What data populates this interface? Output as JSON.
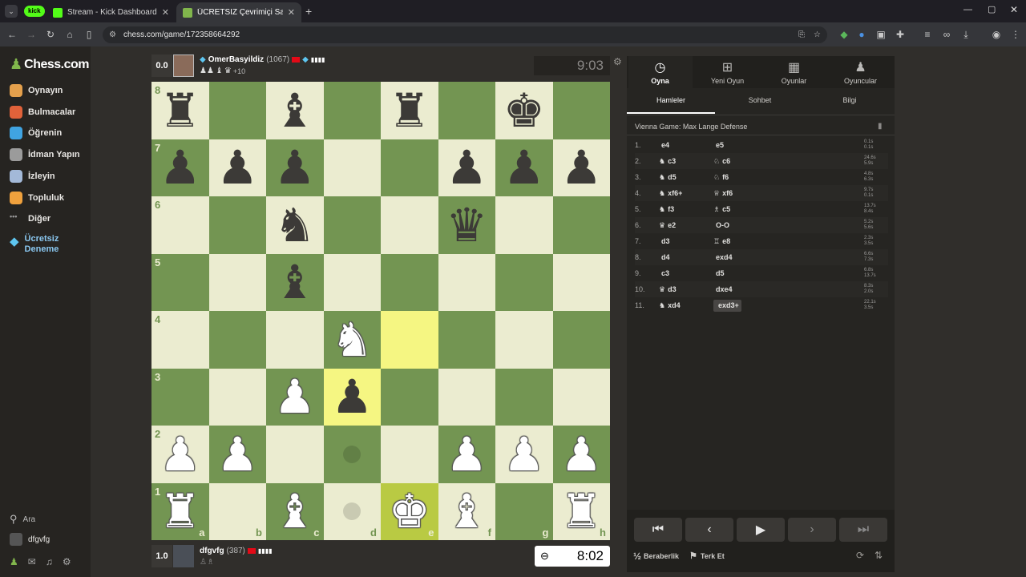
{
  "browser": {
    "tab1_badge": "kick",
    "tab1_title": "Stream - Kick Dashboard",
    "tab2_title": "ÜCRETSİZ Çevrimiçi Satranç Oy",
    "url": "chess.com/game/172358664292"
  },
  "sidebar": {
    "logo": "Chess.com",
    "items": [
      {
        "label": "Oynayın",
        "icon": "pawn-play-icon",
        "color": "#e4a04c"
      },
      {
        "label": "Bulmacalar",
        "icon": "puzzle-icon",
        "color": "#e0623a"
      },
      {
        "label": "Öğrenin",
        "icon": "learn-cap-icon",
        "color": "#40a4e2"
      },
      {
        "label": "İdman Yapın",
        "icon": "drill-icon",
        "color": "#9b9b9b"
      },
      {
        "label": "İzleyin",
        "icon": "binoculars-icon",
        "color": "#a3b9d8"
      },
      {
        "label": "Topluluk",
        "icon": "community-icon",
        "color": "#f0a13d"
      },
      {
        "label": "Diğer",
        "icon": "more-dots-icon",
        "color": "#9b9b9b"
      }
    ],
    "trial_line1": "Ücretsiz",
    "trial_line2": "Deneme",
    "search": "Ara",
    "username": "dfgvfg"
  },
  "top_player": {
    "score": "0.0",
    "name": "OmerBasyildiz",
    "rating": "(1067)",
    "material": "+10",
    "clock": "9:03"
  },
  "bottom_player": {
    "score": "1.0",
    "name": "dfgvfg",
    "rating": "(387)",
    "clock": "8:02"
  },
  "board": {
    "colors": {
      "light": "#ebecd0",
      "dark": "#739552",
      "highlight": "#f5f682"
    },
    "ranks": [
      [
        "br",
        "",
        "bb",
        "",
        "br",
        "",
        "bk",
        ""
      ],
      [
        "bp",
        "bp",
        "bp",
        "",
        "",
        "bp",
        "bp",
        "bp"
      ],
      [
        "",
        "",
        "bn",
        "",
        "",
        "bq",
        "",
        ""
      ],
      [
        "",
        "",
        "bb",
        "",
        "",
        "",
        "",
        ""
      ],
      [
        "",
        "",
        "",
        "wn",
        "",
        "",
        "",
        ""
      ],
      [
        "",
        "",
        "wp",
        "bp",
        "",
        "",
        "",
        ""
      ],
      [
        "wp",
        "wp",
        "",
        "",
        "",
        "wp",
        "wp",
        "wp"
      ],
      [
        "wr",
        "",
        "wb",
        "",
        "wk",
        "wb",
        "",
        "wr"
      ]
    ],
    "files": [
      "a",
      "b",
      "c",
      "d",
      "e",
      "f",
      "g",
      "h"
    ],
    "rank_labels": [
      "8",
      "7",
      "6",
      "5",
      "4",
      "3",
      "2",
      "1"
    ]
  },
  "panel": {
    "tabs": [
      "Oyna",
      "Yeni Oyun",
      "Oyunlar",
      "Oyuncular"
    ],
    "subtabs": [
      "Hamleler",
      "Sohbet",
      "Bilgi"
    ],
    "opening": "Vienna Game: Max Lange Defense",
    "moves": [
      {
        "n": "1.",
        "w": "e4",
        "b": "e5",
        "wt": "0.1s",
        "bt": "0.1s",
        "wp": "",
        "bp": ""
      },
      {
        "n": "2.",
        "w": "c3",
        "b": "c6",
        "wt": "24.6s",
        "bt": "5.9s",
        "wp": "♞",
        "bp": "♘"
      },
      {
        "n": "3.",
        "w": "d5",
        "b": "f6",
        "wt": "4.8s",
        "bt": "6.3s",
        "wp": "♞",
        "bp": "♘"
      },
      {
        "n": "4.",
        "w": "xf6+",
        "b": "xf6",
        "wt": "9.7s",
        "bt": "0.1s",
        "wp": "♞",
        "bp": "♕"
      },
      {
        "n": "5.",
        "w": "f3",
        "b": "c5",
        "wt": "13.7s",
        "bt": "8.4s",
        "wp": "♞",
        "bp": "♗"
      },
      {
        "n": "6.",
        "w": "e2",
        "b": "O-O",
        "wt": "5.2s",
        "bt": "5.6s",
        "wp": "♛",
        "bp": ""
      },
      {
        "n": "7.",
        "w": "d3",
        "b": "e8",
        "wt": "2.3s",
        "bt": "3.5s",
        "wp": "",
        "bp": "♖"
      },
      {
        "n": "8.",
        "w": "d4",
        "b": "exd4",
        "wt": "6.6s",
        "bt": "7.3s",
        "wp": "",
        "bp": ""
      },
      {
        "n": "9.",
        "w": "c3",
        "b": "d5",
        "wt": "6.8s",
        "bt": "13.7s",
        "wp": "",
        "bp": ""
      },
      {
        "n": "10.",
        "w": "d3",
        "b": "dxe4",
        "wt": "8.3s",
        "bt": "2.0s",
        "wp": "♛",
        "bp": ""
      },
      {
        "n": "11.",
        "w": "xd4",
        "b": "exd3+",
        "wt": "22.1s",
        "bt": "3.5s",
        "wp": "♞",
        "bp": ""
      }
    ],
    "draw": "Beraberlik",
    "draw_prefix": "½",
    "resign": "Terk Et"
  }
}
